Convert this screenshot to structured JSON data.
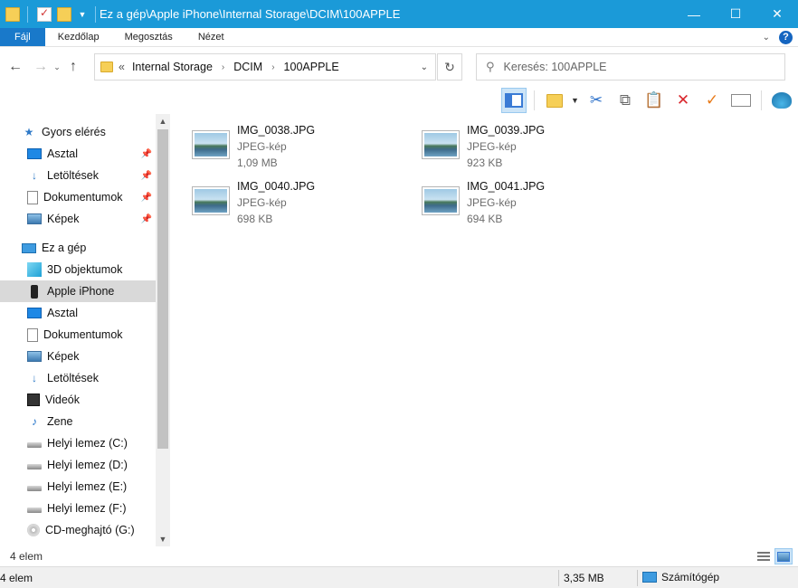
{
  "window": {
    "title": "Ez a gép\\Apple iPhone\\Internal Storage\\DCIM\\100APPLE",
    "minimize": "—",
    "maximize": "☐",
    "close": "✕"
  },
  "ribbon": {
    "tabs": [
      "Fájl",
      "Kezdőlap",
      "Megosztás",
      "Nézet"
    ],
    "collapse": "⌄",
    "help": "?"
  },
  "nav": {
    "back": "←",
    "forward": "→",
    "recent": "⌄",
    "up": "↑",
    "overflow": "«",
    "breadcrumb": [
      "Internal Storage",
      "DCIM",
      "100APPLE"
    ],
    "refresh": "↻"
  },
  "search": {
    "placeholder": "Keresés: 100APPLE"
  },
  "sidebar": {
    "quick_access": {
      "label": "Gyors elérés",
      "items": [
        "Asztal",
        "Letöltések",
        "Dokumentumok",
        "Képek"
      ]
    },
    "this_pc": {
      "label": "Ez a gép",
      "items": [
        "3D objektumok",
        "Apple iPhone",
        "Asztal",
        "Dokumentumok",
        "Képek",
        "Letöltések",
        "Videók",
        "Zene",
        "Helyi lemez (C:)",
        "Helyi lemez (D:)",
        "Helyi lemez (E:)",
        "Helyi lemez (F:)",
        "CD-meghajtó (G:)"
      ]
    },
    "selected": "Apple iPhone"
  },
  "files": [
    {
      "name": "IMG_0038.JPG",
      "type": "JPEG-kép",
      "size": "1,09 MB"
    },
    {
      "name": "IMG_0039.JPG",
      "type": "JPEG-kép",
      "size": "923 KB"
    },
    {
      "name": "IMG_0040.JPG",
      "type": "JPEG-kép",
      "size": "698 KB"
    },
    {
      "name": "IMG_0041.JPG",
      "type": "JPEG-kép",
      "size": "694 KB"
    }
  ],
  "status": {
    "item_count": "4 elem",
    "bottom_count": "4 elem",
    "size": "3,35 MB",
    "location": "Számítógép"
  },
  "colors": {
    "titlebar": "#1b9ad8",
    "file_tab": "#1979ca",
    "selection": "#d9d9d9"
  }
}
